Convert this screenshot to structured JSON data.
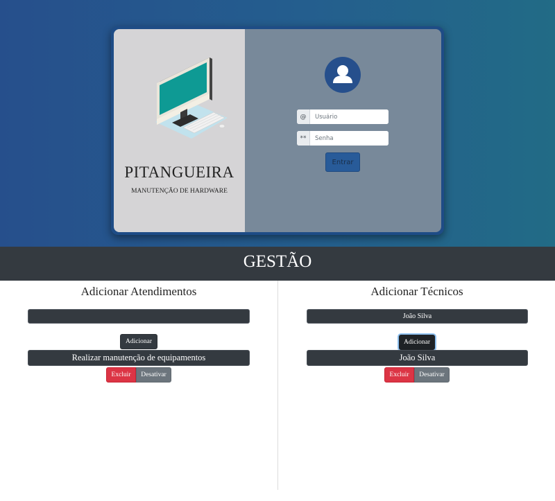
{
  "brand": {
    "title": "PITANGUEIRA",
    "subtitle": "MANUTENÇÃO DE HARDWARE",
    "illustration_icon": "desktop-computer-icon"
  },
  "login": {
    "avatar_icon": "user-avatar-icon",
    "user_addon": "@",
    "user_placeholder": "Usuário",
    "pass_addon": "**",
    "pass_placeholder": "Senha",
    "submit_label": "Entrar"
  },
  "management": {
    "title": "GESTÃO"
  },
  "attendances": {
    "title": "Adicionar Atendimentos",
    "input_value": "",
    "add_label": "Adicionar",
    "items": [
      {
        "label": "Realizar manutenção de equipamentos",
        "delete_label": "Excluir",
        "disable_label": "Desativar"
      }
    ]
  },
  "technicians": {
    "title": "Adicionar Técnicos",
    "input_value": "João Silva",
    "add_label": "Adicionar",
    "items": [
      {
        "label": "João Silva",
        "delete_label": "Excluir",
        "disable_label": "Desativar"
      }
    ]
  },
  "colors": {
    "hero_start": "#264f8c",
    "hero_end": "#226b86",
    "card_left": "#d5d4d6",
    "card_right": "#78899a",
    "dark": "#343a40",
    "danger": "#dc3545",
    "secondary": "#6c757d",
    "primary": "#285b99"
  }
}
